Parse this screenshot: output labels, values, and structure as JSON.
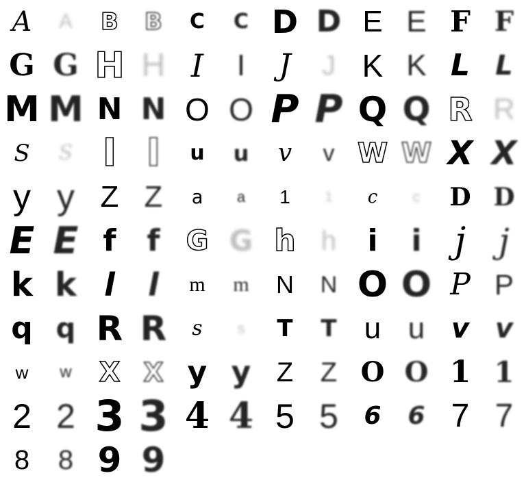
{
  "cells": [
    {
      "char": "A",
      "style": "script",
      "size": 40,
      "variant": "sample"
    },
    {
      "char": "A",
      "style": "sans",
      "size": 30,
      "variant": "faint"
    },
    {
      "char": "B",
      "style": "outline",
      "size": 34,
      "variant": "sample"
    },
    {
      "char": "B",
      "style": "outline",
      "size": 34,
      "variant": "blur"
    },
    {
      "char": "C",
      "style": "box",
      "size": 30,
      "variant": "sample"
    },
    {
      "char": "C",
      "style": "box",
      "size": 30,
      "variant": "blur"
    },
    {
      "char": "D",
      "style": "bold",
      "size": 46,
      "variant": "sample"
    },
    {
      "char": "D",
      "style": "bold",
      "size": 44,
      "variant": "blur"
    },
    {
      "char": "E",
      "style": "sans",
      "size": 44,
      "variant": "sample"
    },
    {
      "char": "E",
      "style": "sans",
      "size": 44,
      "variant": "blur"
    },
    {
      "char": "F",
      "style": "serifb",
      "size": 42,
      "variant": "sample"
    },
    {
      "char": "F",
      "style": "serifb",
      "size": 40,
      "variant": "blur"
    },
    {
      "char": "G",
      "style": "serifb",
      "size": 44,
      "variant": "sample"
    },
    {
      "char": "G",
      "style": "serifb",
      "size": 44,
      "variant": "blur"
    },
    {
      "char": "H",
      "style": "outline",
      "size": 52,
      "variant": "sample"
    },
    {
      "char": "H",
      "style": "sans",
      "size": 48,
      "variant": "faint"
    },
    {
      "char": "I",
      "style": "script",
      "size": 46,
      "variant": "sample"
    },
    {
      "char": "I",
      "style": "sans",
      "size": 44,
      "variant": "blur"
    },
    {
      "char": "J",
      "style": "script",
      "size": 44,
      "variant": "sample"
    },
    {
      "char": "J",
      "style": "sans",
      "size": 40,
      "variant": "faint"
    },
    {
      "char": "K",
      "style": "sans",
      "size": 46,
      "variant": "sample"
    },
    {
      "char": "K",
      "style": "sans",
      "size": 44,
      "variant": "blur"
    },
    {
      "char": "L",
      "style": "italic",
      "size": 44,
      "variant": "sample"
    },
    {
      "char": "L",
      "style": "italic",
      "size": 40,
      "variant": "blur"
    },
    {
      "char": "M",
      "style": "bold",
      "size": 52,
      "variant": "sample"
    },
    {
      "char": "M",
      "style": "bold",
      "size": 52,
      "variant": "blur"
    },
    {
      "char": "N",
      "style": "bold",
      "size": 44,
      "variant": "sample"
    },
    {
      "char": "N",
      "style": "bold",
      "size": 44,
      "variant": "blur"
    },
    {
      "char": "O",
      "style": "sans",
      "size": 46,
      "variant": "sample"
    },
    {
      "char": "O",
      "style": "sans",
      "size": 46,
      "variant": "blur"
    },
    {
      "char": "P",
      "style": "italic",
      "size": 56,
      "variant": "sample"
    },
    {
      "char": "P",
      "style": "italic",
      "size": 56,
      "variant": "blur"
    },
    {
      "char": "Q",
      "style": "bold",
      "size": 50,
      "variant": "sample"
    },
    {
      "char": "Q",
      "style": "bold",
      "size": 48,
      "variant": "blur"
    },
    {
      "char": "R",
      "style": "outline",
      "size": 46,
      "variant": "sample"
    },
    {
      "char": "R",
      "style": "sans",
      "size": 44,
      "variant": "faint"
    },
    {
      "char": "S",
      "style": "script",
      "size": 34,
      "variant": "sample"
    },
    {
      "char": "S",
      "style": "script",
      "size": 30,
      "variant": "faint"
    },
    {
      "char": "I",
      "style": "outline",
      "size": 56,
      "variant": "sample"
    },
    {
      "char": "I",
      "style": "outline",
      "size": 56,
      "variant": "blur"
    },
    {
      "char": "u",
      "style": "bold",
      "size": 30,
      "variant": "sample"
    },
    {
      "char": "u",
      "style": "bold",
      "size": 32,
      "variant": "blur"
    },
    {
      "char": "v",
      "style": "script",
      "size": 36,
      "variant": "sample"
    },
    {
      "char": "v",
      "style": "sans",
      "size": 34,
      "variant": "blur"
    },
    {
      "char": "W",
      "style": "outline",
      "size": 40,
      "variant": "sample"
    },
    {
      "char": "W",
      "style": "outline",
      "size": 40,
      "variant": "blur"
    },
    {
      "char": "X",
      "style": "italic",
      "size": 48,
      "variant": "sample"
    },
    {
      "char": "X",
      "style": "italic",
      "size": 48,
      "variant": "blur"
    },
    {
      "char": "y",
      "style": "sans",
      "size": 52,
      "variant": "sample"
    },
    {
      "char": "y",
      "style": "sans",
      "size": 52,
      "variant": "blur"
    },
    {
      "char": "Z",
      "style": "sans",
      "size": 44,
      "variant": "sample"
    },
    {
      "char": "Z",
      "style": "sans",
      "size": 44,
      "variant": "blur"
    },
    {
      "char": "a",
      "style": "mono",
      "size": 28,
      "variant": "sample"
    },
    {
      "char": "a",
      "style": "sans",
      "size": 22,
      "variant": "blur"
    },
    {
      "char": "1",
      "style": "sans",
      "size": 28,
      "variant": "sample"
    },
    {
      "char": "1",
      "style": "sans",
      "size": 20,
      "variant": "faint"
    },
    {
      "char": "c",
      "style": "script",
      "size": 26,
      "variant": "sample"
    },
    {
      "char": "c",
      "style": "sans",
      "size": 22,
      "variant": "faint"
    },
    {
      "char": "D",
      "style": "serifb",
      "size": 36,
      "variant": "sample"
    },
    {
      "char": "D",
      "style": "serifb",
      "size": 36,
      "variant": "blur"
    },
    {
      "char": "E",
      "style": "italic",
      "size": 54,
      "variant": "sample"
    },
    {
      "char": "E",
      "style": "italic",
      "size": 54,
      "variant": "blur"
    },
    {
      "char": "f",
      "style": "bold",
      "size": 44,
      "variant": "sample"
    },
    {
      "char": "f",
      "style": "bold",
      "size": 44,
      "variant": "blur"
    },
    {
      "char": "G",
      "style": "outline",
      "size": 40,
      "variant": "sample"
    },
    {
      "char": "G",
      "style": "bold",
      "size": 42,
      "variant": "faint"
    },
    {
      "char": "h",
      "style": "outline",
      "size": 44,
      "variant": "sample"
    },
    {
      "char": "h",
      "style": "sans",
      "size": 40,
      "variant": "faint"
    },
    {
      "char": "i",
      "style": "bold",
      "size": 44,
      "variant": "sample"
    },
    {
      "char": "i",
      "style": "bold",
      "size": 44,
      "variant": "blur"
    },
    {
      "char": "j",
      "style": "script",
      "size": 52,
      "variant": "sample"
    },
    {
      "char": "j",
      "style": "script",
      "size": 50,
      "variant": "blur"
    },
    {
      "char": "k",
      "style": "bold",
      "size": 48,
      "variant": "sample"
    },
    {
      "char": "k",
      "style": "bold",
      "size": 48,
      "variant": "blur"
    },
    {
      "char": "l",
      "style": "italic",
      "size": 46,
      "variant": "sample"
    },
    {
      "char": "l",
      "style": "italic",
      "size": 46,
      "variant": "blur"
    },
    {
      "char": "m",
      "style": "serif",
      "size": 30,
      "variant": "sample"
    },
    {
      "char": "m",
      "style": "serif",
      "size": 30,
      "variant": "blur"
    },
    {
      "char": "N",
      "style": "sans",
      "size": 36,
      "variant": "sample"
    },
    {
      "char": "N",
      "style": "sans",
      "size": 34,
      "variant": "blur"
    },
    {
      "char": "O",
      "style": "bold",
      "size": 52,
      "variant": "sample"
    },
    {
      "char": "O",
      "style": "bold",
      "size": 52,
      "variant": "blur"
    },
    {
      "char": "P",
      "style": "script",
      "size": 44,
      "variant": "sample"
    },
    {
      "char": "P",
      "style": "sans",
      "size": 42,
      "variant": "blur"
    },
    {
      "char": "q",
      "style": "bold",
      "size": 44,
      "variant": "sample"
    },
    {
      "char": "q",
      "style": "bold",
      "size": 40,
      "variant": "blur"
    },
    {
      "char": "R",
      "style": "bold",
      "size": 50,
      "variant": "sample"
    },
    {
      "char": "R",
      "style": "bold",
      "size": 50,
      "variant": "blur"
    },
    {
      "char": "s",
      "style": "script",
      "size": 30,
      "variant": "sample"
    },
    {
      "char": "s",
      "style": "sans",
      "size": 22,
      "variant": "faint"
    },
    {
      "char": "T",
      "style": "bold",
      "size": 34,
      "variant": "sample"
    },
    {
      "char": "T",
      "style": "bold",
      "size": 34,
      "variant": "blur"
    },
    {
      "char": "u",
      "style": "sans",
      "size": 44,
      "variant": "sample"
    },
    {
      "char": "u",
      "style": "sans",
      "size": 44,
      "variant": "blur"
    },
    {
      "char": "v",
      "style": "italic",
      "size": 40,
      "variant": "sample"
    },
    {
      "char": "v",
      "style": "italic",
      "size": 40,
      "variant": "blur"
    },
    {
      "char": "w",
      "style": "sans",
      "size": 26,
      "variant": "sample"
    },
    {
      "char": "w",
      "style": "sans",
      "size": 24,
      "variant": "blur"
    },
    {
      "char": "X",
      "style": "outline",
      "size": 40,
      "variant": "sample"
    },
    {
      "char": "X",
      "style": "outline",
      "size": 38,
      "variant": "blur"
    },
    {
      "char": "y",
      "style": "box",
      "size": 44,
      "variant": "sample"
    },
    {
      "char": "y",
      "style": "box",
      "size": 44,
      "variant": "blur"
    },
    {
      "char": "Z",
      "style": "sans",
      "size": 40,
      "variant": "sample"
    },
    {
      "char": "Z",
      "style": "sans",
      "size": 40,
      "variant": "blur"
    },
    {
      "char": "O",
      "style": "serifb",
      "size": 40,
      "variant": "sample"
    },
    {
      "char": "O",
      "style": "serifb",
      "size": 40,
      "variant": "blur"
    },
    {
      "char": "1",
      "style": "serifb",
      "size": 44,
      "variant": "sample"
    },
    {
      "char": "1",
      "style": "serifb",
      "size": 42,
      "variant": "blur"
    },
    {
      "char": "2",
      "style": "sans",
      "size": 50,
      "variant": "sample"
    },
    {
      "char": "2",
      "style": "sans",
      "size": 50,
      "variant": "blur"
    },
    {
      "char": "3",
      "style": "bold",
      "size": 62,
      "variant": "sample"
    },
    {
      "char": "3",
      "style": "bold",
      "size": 62,
      "variant": "blur"
    },
    {
      "char": "4",
      "style": "serifb",
      "size": 52,
      "variant": "sample"
    },
    {
      "char": "4",
      "style": "serifb",
      "size": 52,
      "variant": "blur"
    },
    {
      "char": "5",
      "style": "sans",
      "size": 50,
      "variant": "sample"
    },
    {
      "char": "5",
      "style": "sans",
      "size": 50,
      "variant": "blur"
    },
    {
      "char": "6",
      "style": "italic",
      "size": 36,
      "variant": "sample"
    },
    {
      "char": "6",
      "style": "italic",
      "size": 36,
      "variant": "blur"
    },
    {
      "char": "7",
      "style": "sans",
      "size": 48,
      "variant": "sample"
    },
    {
      "char": "7",
      "style": "sans",
      "size": 48,
      "variant": "blur"
    },
    {
      "char": "8",
      "style": "sans",
      "size": 40,
      "variant": "sample"
    },
    {
      "char": "8",
      "style": "sans",
      "size": 40,
      "variant": "blur"
    },
    {
      "char": "9",
      "style": "bold",
      "size": 50,
      "variant": "sample"
    },
    {
      "char": "9",
      "style": "bold",
      "size": 50,
      "variant": "blur"
    }
  ]
}
